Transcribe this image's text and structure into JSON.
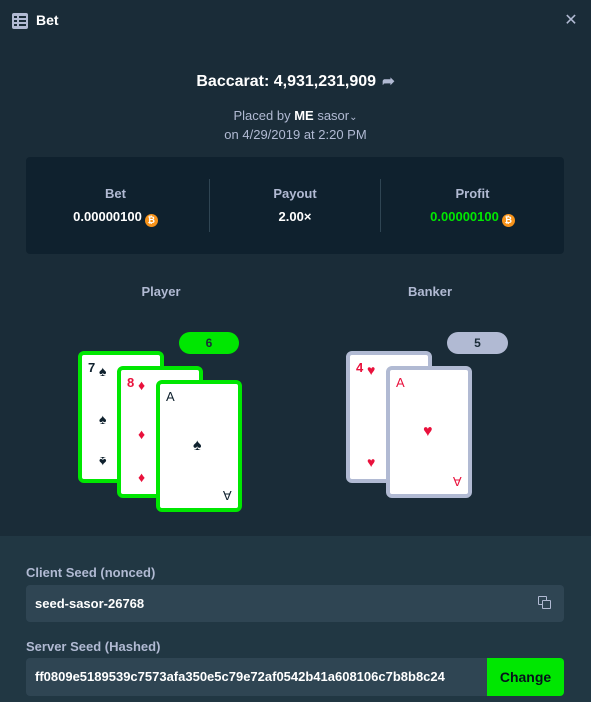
{
  "window": {
    "title": "Bet",
    "title_icon": "bet-list-icon",
    "close_icon": "close-icon",
    "close_glyph": "✕"
  },
  "bet": {
    "game_title": "Baccarat: 4,931,231,909",
    "share_icon": "share-arrow-icon",
    "share_glyph": "➦",
    "placed_prefix": "Placed by",
    "placed_badge": "ME",
    "username": "sasor",
    "dropdown_glyph": "⌄",
    "date": "on 4/29/2019 at 2:20 PM"
  },
  "stats": {
    "bet_label": "Bet",
    "bet_value": "0.00000100",
    "payout_label": "Payout",
    "payout_value": "2.00×",
    "profit_label": "Profit",
    "profit_value": "0.00000100",
    "currency_icon": "bitcoin-icon",
    "currency_glyph": "₿",
    "profit_color": "#00e701"
  },
  "player": {
    "label": "Player",
    "score": "6",
    "badge_color": "#00e701",
    "cards": [
      {
        "rank": "7",
        "suit": "♠",
        "color": "black"
      },
      {
        "rank": "8",
        "suit": "♦",
        "color": "red"
      },
      {
        "rank": "A",
        "suit": "♠",
        "color": "black"
      }
    ]
  },
  "banker": {
    "label": "Banker",
    "score": "5",
    "badge_color": "#b1bad3",
    "cards": [
      {
        "rank": "4",
        "suit": "♥",
        "color": "red"
      },
      {
        "rank": "A",
        "suit": "♥",
        "color": "red"
      }
    ]
  },
  "seeds": {
    "client_label": "Client Seed (nonced)",
    "client_value": "seed-sasor-26768",
    "copy_icon": "copy-icon",
    "server_label": "Server Seed (Hashed)",
    "server_value": "ff0809e5189539c7573afa350e5c79e72af0542b41a608106c7b8b8c24",
    "change_label": "Change"
  },
  "colors": {
    "background": "#1a2c38",
    "panel": "#0f212e",
    "accent_green": "#00e701",
    "muted": "#b1bad3",
    "card_red": "#e9113c"
  }
}
